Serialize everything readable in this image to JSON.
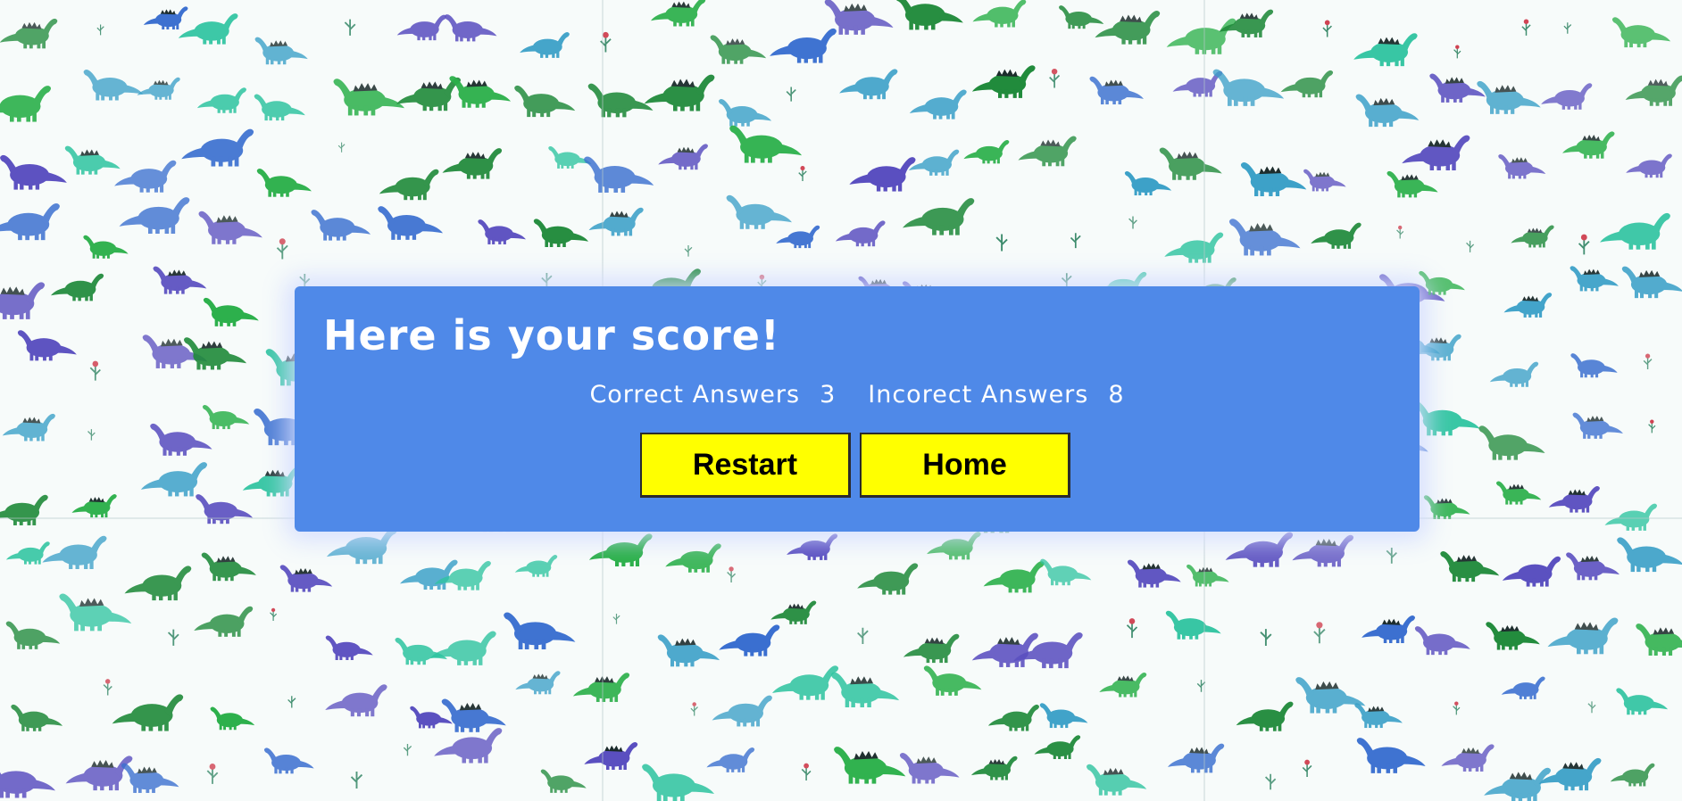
{
  "background": {
    "pattern": "dinosaur-watercolor-tile",
    "colors": [
      "#1f8a3a",
      "#2bb04a",
      "#3aa0c8",
      "#3a6fd0",
      "#5a4fc0",
      "#2ec4a0",
      "#d04050"
    ]
  },
  "score_panel": {
    "title": "Here is your score!",
    "correct_label": "Correct Answers",
    "correct_value": "3",
    "incorrect_label": "Incorect Answers",
    "incorrect_value": "8",
    "panel_color": "#4f89e8",
    "button_color": "#ffff00"
  },
  "buttons": {
    "restart_label": "Restart",
    "home_label": "Home"
  }
}
